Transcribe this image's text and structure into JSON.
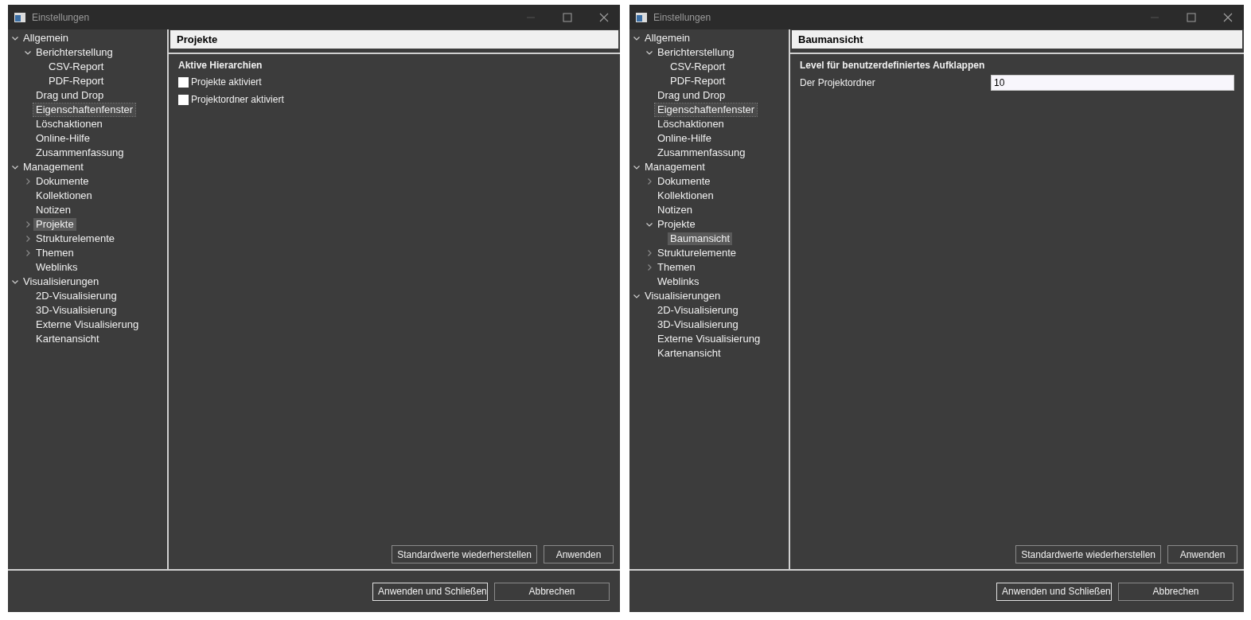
{
  "windows": [
    {
      "title": "Einstellungen",
      "tree": [
        {
          "label": "Allgemein",
          "expanded": true,
          "selected": false,
          "focused": false,
          "children": [
            {
              "label": "Berichterstellung",
              "expanded": true,
              "selected": false,
              "focused": false,
              "children": [
                {
                  "label": "CSV-Report",
                  "selected": false,
                  "focused": false
                },
                {
                  "label": "PDF-Report",
                  "selected": false,
                  "focused": false
                }
              ]
            },
            {
              "label": "Drag und Drop",
              "selected": false,
              "focused": false
            },
            {
              "label": "Eigenschaftenfenster",
              "selected": false,
              "focused": true
            },
            {
              "label": "Löschaktionen",
              "selected": false,
              "focused": false
            },
            {
              "label": "Online-Hilfe",
              "selected": false,
              "focused": false
            },
            {
              "label": "Zusammenfassung",
              "selected": false,
              "focused": false
            }
          ]
        },
        {
          "label": "Management",
          "expanded": true,
          "selected": false,
          "focused": false,
          "children": [
            {
              "label": "Dokumente",
              "expanded": false,
              "selected": false,
              "focused": false
            },
            {
              "label": "Kollektionen",
              "selected": false,
              "focused": false
            },
            {
              "label": "Notizen",
              "selected": false,
              "focused": false
            },
            {
              "label": "Projekte",
              "expanded": false,
              "selected": true,
              "focused": false
            },
            {
              "label": "Strukturelemente",
              "expanded": false,
              "selected": false,
              "focused": false
            },
            {
              "label": "Themen",
              "expanded": false,
              "selected": false,
              "focused": false
            },
            {
              "label": "Weblinks",
              "selected": false,
              "focused": false
            }
          ]
        },
        {
          "label": "Visualisierungen",
          "expanded": true,
          "selected": false,
          "focused": false,
          "children": [
            {
              "label": "2D-Visualisierung",
              "selected": false,
              "focused": false
            },
            {
              "label": "3D-Visualisierung",
              "selected": false,
              "focused": false
            },
            {
              "label": "Externe Visualisierung",
              "selected": false,
              "focused": false
            },
            {
              "label": "Kartenansicht",
              "selected": false,
              "focused": false
            }
          ]
        }
      ],
      "page": {
        "title": "Projekte",
        "items": [
          {
            "kind": "heading",
            "label": "Aktive Hierarchien"
          },
          {
            "kind": "checkbox",
            "label": "Projekte aktiviert",
            "checked": false
          },
          {
            "kind": "checkbox",
            "label": "Projektordner aktiviert",
            "checked": false
          }
        ]
      },
      "page_buttons": [
        {
          "label": "Standardwerte wiederherstellen",
          "default": false
        },
        {
          "label": "Anwenden",
          "default": false
        }
      ],
      "footer_buttons": [
        {
          "label": "Anwenden und Schließen",
          "default": true
        },
        {
          "label": "Abbrechen",
          "default": false
        }
      ]
    },
    {
      "title": "Einstellungen",
      "tree": [
        {
          "label": "Allgemein",
          "expanded": true,
          "selected": false,
          "focused": false,
          "children": [
            {
              "label": "Berichterstellung",
              "expanded": true,
              "selected": false,
              "focused": false,
              "children": [
                {
                  "label": "CSV-Report",
                  "selected": false,
                  "focused": false
                },
                {
                  "label": "PDF-Report",
                  "selected": false,
                  "focused": false
                }
              ]
            },
            {
              "label": "Drag und Drop",
              "selected": false,
              "focused": false
            },
            {
              "label": "Eigenschaftenfenster",
              "selected": false,
              "focused": true
            },
            {
              "label": "Löschaktionen",
              "selected": false,
              "focused": false
            },
            {
              "label": "Online-Hilfe",
              "selected": false,
              "focused": false
            },
            {
              "label": "Zusammenfassung",
              "selected": false,
              "focused": false
            }
          ]
        },
        {
          "label": "Management",
          "expanded": true,
          "selected": false,
          "focused": false,
          "children": [
            {
              "label": "Dokumente",
              "expanded": false,
              "selected": false,
              "focused": false
            },
            {
              "label": "Kollektionen",
              "selected": false,
              "focused": false
            },
            {
              "label": "Notizen",
              "selected": false,
              "focused": false
            },
            {
              "label": "Projekte",
              "expanded": true,
              "selected": false,
              "focused": false,
              "children": [
                {
                  "label": "Baumansicht",
                  "selected": true,
                  "focused": false
                }
              ]
            },
            {
              "label": "Strukturelemente",
              "expanded": false,
              "selected": false,
              "focused": false
            },
            {
              "label": "Themen",
              "expanded": false,
              "selected": false,
              "focused": false
            },
            {
              "label": "Weblinks",
              "selected": false,
              "focused": false
            }
          ]
        },
        {
          "label": "Visualisierungen",
          "expanded": true,
          "selected": false,
          "focused": false,
          "children": [
            {
              "label": "2D-Visualisierung",
              "selected": false,
              "focused": false
            },
            {
              "label": "3D-Visualisierung",
              "selected": false,
              "focused": false
            },
            {
              "label": "Externe Visualisierung",
              "selected": false,
              "focused": false
            },
            {
              "label": "Kartenansicht",
              "selected": false,
              "focused": false
            }
          ]
        }
      ],
      "page": {
        "title": "Baumansicht",
        "items": [
          {
            "kind": "heading",
            "label": "Level für benutzerdefiniertes Aufklappen"
          },
          {
            "kind": "number_field",
            "label": "Der Projektordner",
            "value": "10"
          }
        ]
      },
      "page_buttons": [
        {
          "label": "Standardwerte wiederherstellen",
          "default": false
        },
        {
          "label": "Anwenden",
          "default": false
        }
      ],
      "footer_buttons": [
        {
          "label": "Anwenden und Schließen",
          "default": true
        },
        {
          "label": "Abbrechen",
          "default": false
        }
      ]
    }
  ]
}
